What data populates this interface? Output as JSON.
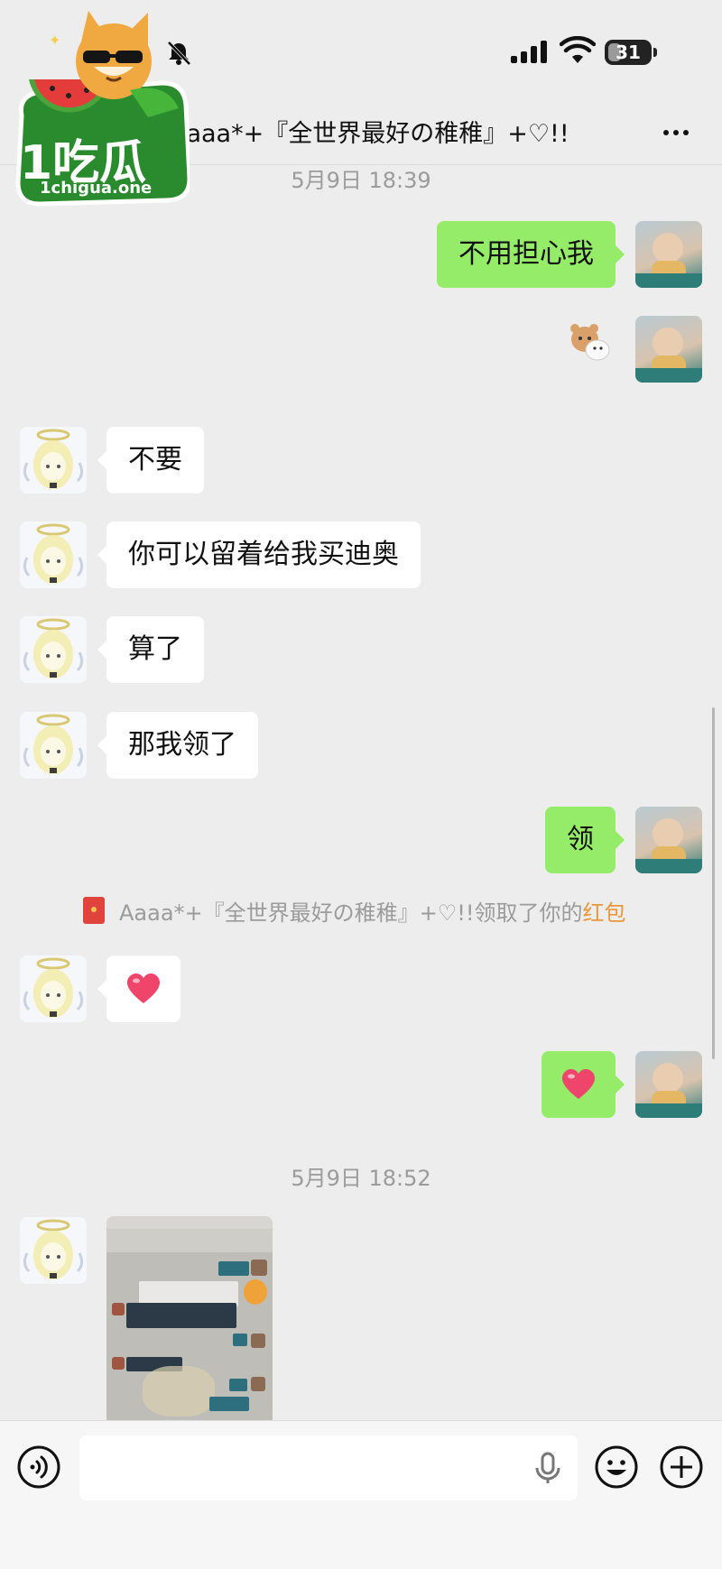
{
  "status_bar": {
    "battery": "31",
    "battery_level": 0.31
  },
  "header": {
    "title": "Aaaa*+『全世界最好の稚稚』+♡!!"
  },
  "watermark": {
    "logo": "1吃瓜",
    "site": "1chigua.one"
  },
  "messages": [
    {
      "type": "time",
      "text": "5月9日 18:39"
    },
    {
      "type": "text",
      "side": "out",
      "text": "不用担心我"
    },
    {
      "type": "sticker",
      "side": "out",
      "sticker": "bear-sticker"
    },
    {
      "type": "text",
      "side": "in",
      "text": "不要"
    },
    {
      "type": "text",
      "side": "in",
      "text": "你可以留着给我买迪奥"
    },
    {
      "type": "text",
      "side": "in",
      "text": "算了"
    },
    {
      "type": "text",
      "side": "in",
      "text": "那我领了"
    },
    {
      "type": "text",
      "side": "out",
      "text": "领"
    },
    {
      "type": "system",
      "prefix": "Aaaa*+『全世界最好の稚稚』+♡!!领取了你的",
      "link": "红包"
    },
    {
      "type": "emoji",
      "side": "in",
      "emoji": "heart-emoji"
    },
    {
      "type": "emoji",
      "side": "out",
      "emoji": "heart-emoji"
    },
    {
      "type": "time",
      "text": "5月9日 18:52"
    },
    {
      "type": "image",
      "side": "in",
      "content": "chat-screenshot"
    }
  ],
  "input_bar": {
    "placeholder": ""
  },
  "colors": {
    "bubble_out": "#95ec69",
    "bubble_in": "#ffffff",
    "background": "#ededed",
    "link": "#e9973a",
    "red_packet": "#e0433c"
  }
}
